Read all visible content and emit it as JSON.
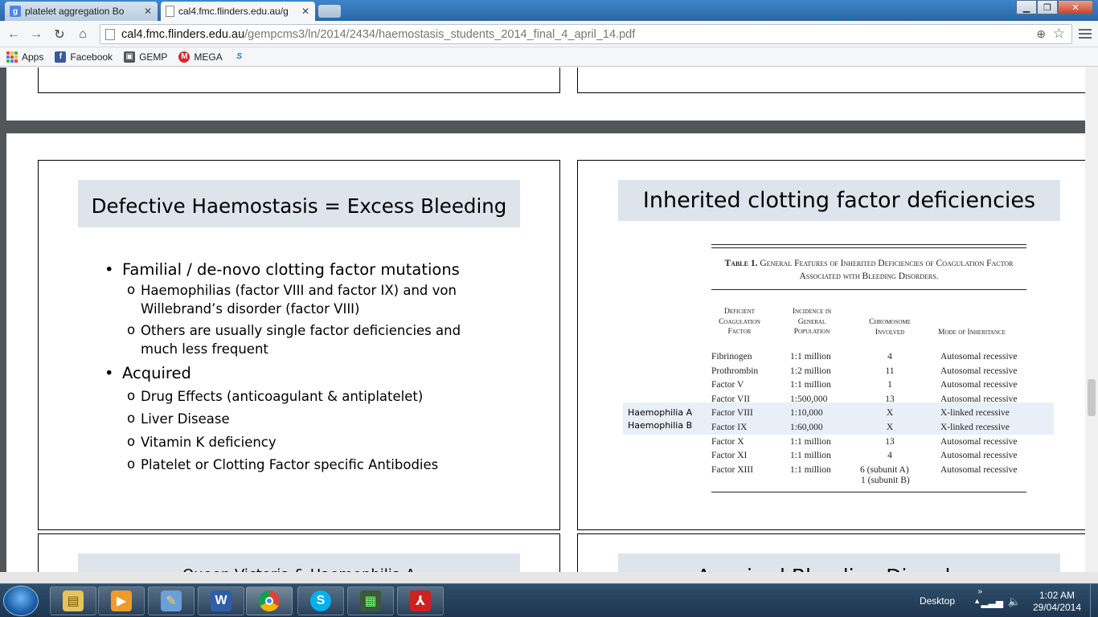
{
  "browser": {
    "tabs": [
      {
        "title": "platelet aggregation Bo",
        "favicon": "google-icon",
        "active": false
      },
      {
        "title": "cal4.fmc.flinders.edu.au/g",
        "favicon": "page-icon",
        "active": true
      }
    ],
    "url_host": "cal4.fmc.flinders.edu.au",
    "url_path": "/gempcms3/ln/2014/2434/haemostasis_students_2014_final_4_april_14.pdf",
    "bookmarks": [
      {
        "label": "Apps",
        "icon": "apps-grid-icon"
      },
      {
        "label": "Facebook",
        "icon": "facebook-icon"
      },
      {
        "label": "GEMP",
        "icon": "gemp-icon"
      },
      {
        "label": "MEGA",
        "icon": "mega-icon"
      },
      {
        "label": "",
        "icon": "s-icon"
      }
    ]
  },
  "slide_left": {
    "title": "Defective Haemostasis = Excess Bleeding",
    "bullets": [
      {
        "text": "Familial / de-novo clotting factor mutations",
        "sub": [
          "Haemophilias (factor VIII and factor IX) and von Willebrand’s disorder (factor VIII)",
          "Others are usually single factor deficiencies and much less frequent"
        ]
      },
      {
        "text": "Acquired",
        "sub": [
          "Drug Effects (anticoagulant & antiplatelet)",
          "Liver Disease",
          "Vitamin K deficiency",
          "Platelet or Clotting Factor specific Antibodies"
        ]
      }
    ]
  },
  "slide_right": {
    "title": "Inherited clotting factor deficiencies",
    "table": {
      "caption_label": "Table 1.",
      "caption_text": "General Features of Inherited Deficiencies of Coagulation Factor Associated with Bleeding Disorders.",
      "headers": [
        "Deficient Coagulation Factor",
        "Incidence in General Population",
        "Chromosome Involved",
        "Mode of Inheritance"
      ],
      "rows": [
        [
          "Fibrinogen",
          "1:1 million",
          "4",
          "Autosomal recessive"
        ],
        [
          "Prothrombin",
          "1:2 million",
          "11",
          "Autosomal recessive"
        ],
        [
          "Factor V",
          "1:1 million",
          "1",
          "Autosomal recessive"
        ],
        [
          "Factor VII",
          "1:500,000",
          "13",
          "Autosomal recessive"
        ],
        [
          "Factor VIII",
          "1:10,000",
          "X",
          "X-linked recessive"
        ],
        [
          "Factor IX",
          "1:60,000",
          "X",
          "X-linked recessive"
        ],
        [
          "Factor X",
          "1:1 million",
          "13",
          "Autosomal recessive"
        ],
        [
          "Factor XI",
          "1:1 million",
          "4",
          "Autosomal recessive"
        ],
        [
          "Factor XIII",
          "1:1 million",
          "6 (subunit A)",
          "Autosomal recessive"
        ]
      ],
      "row_extra": "1 (subunit B)",
      "highlight_labels": [
        "Haemophilia A",
        "Haemophilia B"
      ]
    }
  },
  "next_slides": {
    "left_title_partial": "Queen Victoria & Haemophilia A",
    "right_title_partial": "Acquired Bleeding Disorders"
  },
  "taskbar": {
    "desktop_label": "Desktop",
    "time": "1:02 AM",
    "date": "29/04/2014",
    "apps": [
      "explorer-icon",
      "media-player-icon",
      "paint-icon",
      "word-icon",
      "chrome-icon",
      "skype-icon",
      "task-manager-icon",
      "acrobat-icon"
    ]
  }
}
